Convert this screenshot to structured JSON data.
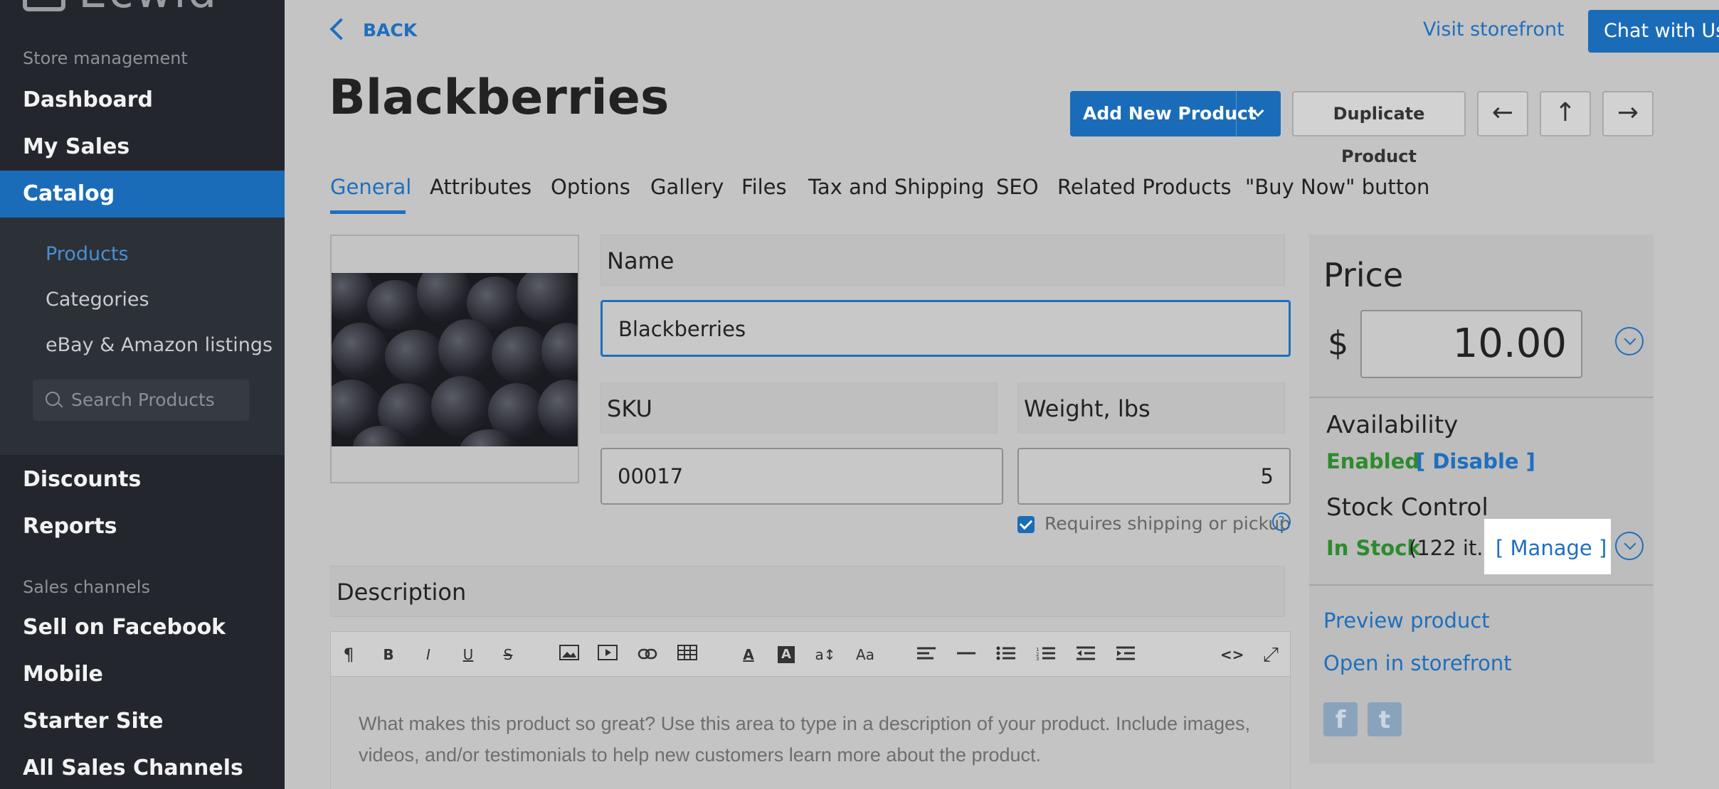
{
  "sidebar": {
    "logo": "Ecwid",
    "section_store": "Store management",
    "items": {
      "dashboard": "Dashboard",
      "my_sales": "My Sales",
      "catalog": "Catalog",
      "discounts": "Discounts",
      "reports": "Reports"
    },
    "catalog_sub": {
      "products": "Products",
      "categories": "Categories",
      "ebay": "eBay & Amazon listings"
    },
    "search_placeholder": "Search Products",
    "section_channels": "Sales channels",
    "channels": {
      "facebook": "Sell on Facebook",
      "mobile": "Mobile",
      "starter": "Starter Site",
      "all": "All Sales Channels"
    }
  },
  "header": {
    "back": "BACK",
    "visit_storefront": "Visit storefront",
    "chat": "Chat with Us"
  },
  "product": {
    "title": "Blackberries",
    "add_new": "Add New Product",
    "duplicate": "Duplicate Product",
    "nav_prev": "←",
    "nav_up": "↑",
    "nav_next": "→"
  },
  "tabs": {
    "general": "General",
    "attributes": "Attributes",
    "options": "Options",
    "gallery": "Gallery",
    "files": "Files",
    "tax": "Tax and Shipping",
    "seo": "SEO",
    "related": "Related Products",
    "buy_now": "\"Buy Now\" button"
  },
  "form": {
    "name_label": "Name",
    "name_value": "Blackberries",
    "sku_label": "SKU",
    "sku_value": "00017",
    "weight_label": "Weight, lbs",
    "weight_value": "5",
    "shipping_label": "Requires shipping or pickup",
    "help": "?",
    "description_label": "Description",
    "description_placeholder": "What makes this product so great? Use this area to type in a description of your product. Include images, videos, and/or testimonials to help new customers learn more about the product."
  },
  "toolbar": {
    "paragraph": "¶",
    "bold": "B",
    "italic": "I",
    "underline": "U",
    "strike": "S",
    "font_size": "a↕",
    "font_family": "Aa",
    "text_color": "A",
    "bg_color": "A",
    "code": "<>",
    "fullscreen": "⤢"
  },
  "panel": {
    "price_label": "Price",
    "currency": "$",
    "price_value": "10.00",
    "availability_label": "Availability",
    "enabled": "Enabled",
    "disable": "[ Disable ]",
    "stock_label": "Stock Control",
    "in_stock": "In Stock",
    "stock_count": "(122 it.)",
    "manage": "[ Manage ]",
    "preview": "Preview product",
    "open_storefront": "Open in storefront",
    "facebook": "f",
    "twitter": "t"
  },
  "colors": {
    "accent": "#1a6cb8",
    "sidebar": "#23272d",
    "success": "#2d8b2d"
  }
}
